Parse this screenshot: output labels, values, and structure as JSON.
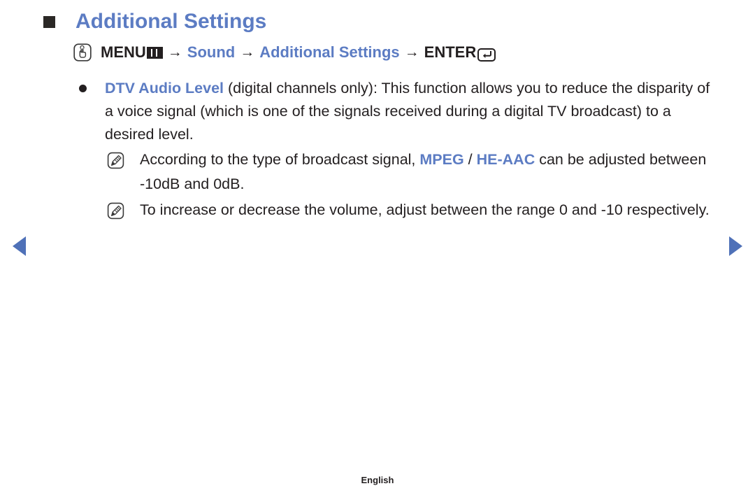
{
  "page": {
    "title": "Additional Settings",
    "footer_label": "English",
    "accent_blue": "#5c7cc3",
    "arrow_blue": "#4f71b8",
    "text_black": "#231f20"
  },
  "menu_path": {
    "key_icon": "menu-key-press-icon",
    "menu_label": "MENU",
    "menu_glyph": "menu-bars-icon",
    "arrow": "→",
    "step_sound": "Sound",
    "step_additional_settings": "Additional Settings",
    "enter_label": "ENTER",
    "enter_glyph": "enter-return-icon"
  },
  "bullet": {
    "marker": "●",
    "term": "DTV Audio Level",
    "body": " (digital channels only): This function allows you to reduce the disparity of a voice signal (which is one of the signals received during a digital TV broadcast) to a desired level."
  },
  "notes": [
    {
      "icon": "note-pencil-icon",
      "text_before": "According to the type of broadcast signal, ",
      "highlight_1": "MPEG",
      "separator": " / ",
      "highlight_2": "HE-AAC",
      "text_after": " can be adjusted between -10dB and 0dB."
    },
    {
      "icon": "note-pencil-icon",
      "text": "To increase or decrease the volume, adjust between the range 0 and -10 respectively."
    }
  ],
  "navigation": {
    "prev_label": "previous-page-arrow",
    "next_label": "next-page-arrow"
  }
}
